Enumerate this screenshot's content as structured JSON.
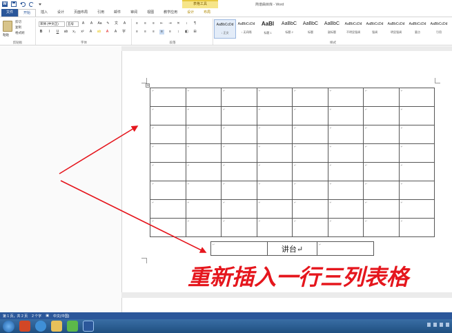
{
  "window": {
    "context_tools_label": "表格工具",
    "title": "简谱曲目库 - Word",
    "qat_icons": [
      "word-icon",
      "save-icon",
      "undo-icon",
      "redo-icon",
      "customize-icon"
    ]
  },
  "tabs": [
    {
      "label": "文件",
      "kind": "file"
    },
    {
      "label": "开始",
      "kind": "active"
    },
    {
      "label": "插入",
      "kind": ""
    },
    {
      "label": "设计",
      "kind": ""
    },
    {
      "label": "页面布局",
      "kind": ""
    },
    {
      "label": "引用",
      "kind": ""
    },
    {
      "label": "邮件",
      "kind": ""
    },
    {
      "label": "审阅",
      "kind": ""
    },
    {
      "label": "视图",
      "kind": ""
    },
    {
      "label": "教学应用",
      "kind": ""
    },
    {
      "label": "设计",
      "kind": "ctx"
    },
    {
      "label": "布局",
      "kind": "ctx"
    }
  ],
  "ribbon": {
    "clipboard": {
      "paste": "粘贴",
      "cut": "剪切",
      "copy": "复制",
      "format_painter": "格式刷",
      "label": "剪贴板"
    },
    "font": {
      "font_name": "宋体 (中文正)",
      "font_size": "五号",
      "label": "字体"
    },
    "paragraph": {
      "label": "段落"
    },
    "styles": {
      "label": "样式",
      "items": [
        {
          "sample": "AaBbCcDd",
          "name": "↓ 正文"
        },
        {
          "sample": "AaBbCcDd",
          "name": "↓ 无间隔"
        },
        {
          "sample": "AaBl",
          "name": "标题 1"
        },
        {
          "sample": "AaBbC",
          "name": "标题 2"
        },
        {
          "sample": "AaBbC",
          "name": "标题"
        },
        {
          "sample": "AaBbC",
          "name": "副标题"
        },
        {
          "sample": "AaBbCcDd",
          "name": "不明显强调"
        },
        {
          "sample": "AaBbCcDd",
          "name": "强调"
        },
        {
          "sample": "AaBbCcDd",
          "name": "明显强调"
        },
        {
          "sample": "AaBbCcDd",
          "name": "要点"
        },
        {
          "sample": "AaBbCcDd",
          "name": "引用"
        }
      ]
    }
  },
  "document": {
    "table": {
      "rows": 8,
      "cols": 8,
      "cell_mark": "↵"
    },
    "small_table": {
      "cells": [
        "↵",
        "讲台↵",
        "↵"
      ]
    },
    "handle_glyph": "⊞",
    "caption": "重新插入一行三列表格"
  },
  "status": {
    "page": "第 1 页，共 2 页",
    "words": "2 个字",
    "lang": "中文(中国)"
  },
  "colors": {
    "accent": "#2b579a",
    "arrow": "#e5161d",
    "caption": "#e5161d"
  }
}
